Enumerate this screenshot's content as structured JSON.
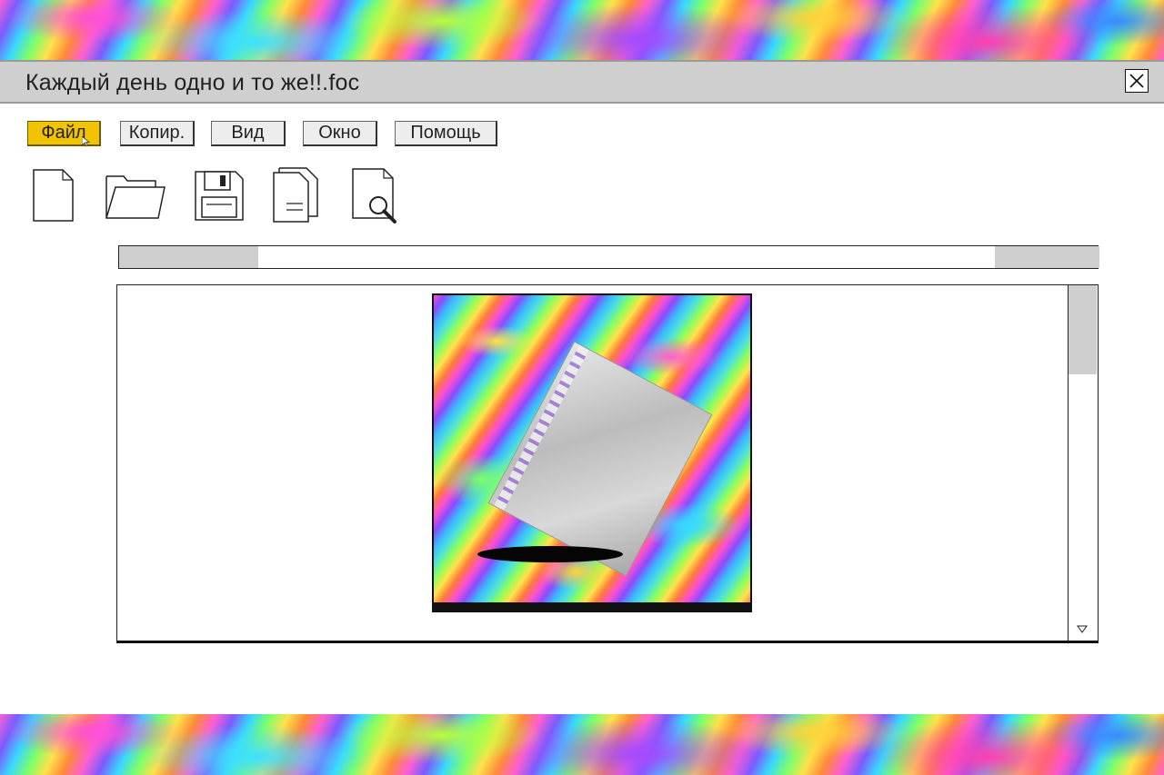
{
  "window": {
    "title": "Каждый день одно и то же!!.foc",
    "close_icon": "close-icon"
  },
  "menu": [
    {
      "label": "Файл",
      "active": true
    },
    {
      "label": "Копир.",
      "active": false
    },
    {
      "label": "Вид",
      "active": false
    },
    {
      "label": "Окно",
      "active": false
    },
    {
      "label": "Помощь",
      "active": false
    }
  ],
  "toolbar": {
    "icons": [
      "new-document-icon",
      "open-folder-icon",
      "save-floppy-icon",
      "copy-document-icon",
      "preview-search-icon"
    ]
  },
  "colors": {
    "active_menu": "#f2c400",
    "chrome_gray": "#cfcfcf",
    "border": "#222222"
  },
  "document": {
    "image": "psychedelic-sleeve-artwork"
  }
}
